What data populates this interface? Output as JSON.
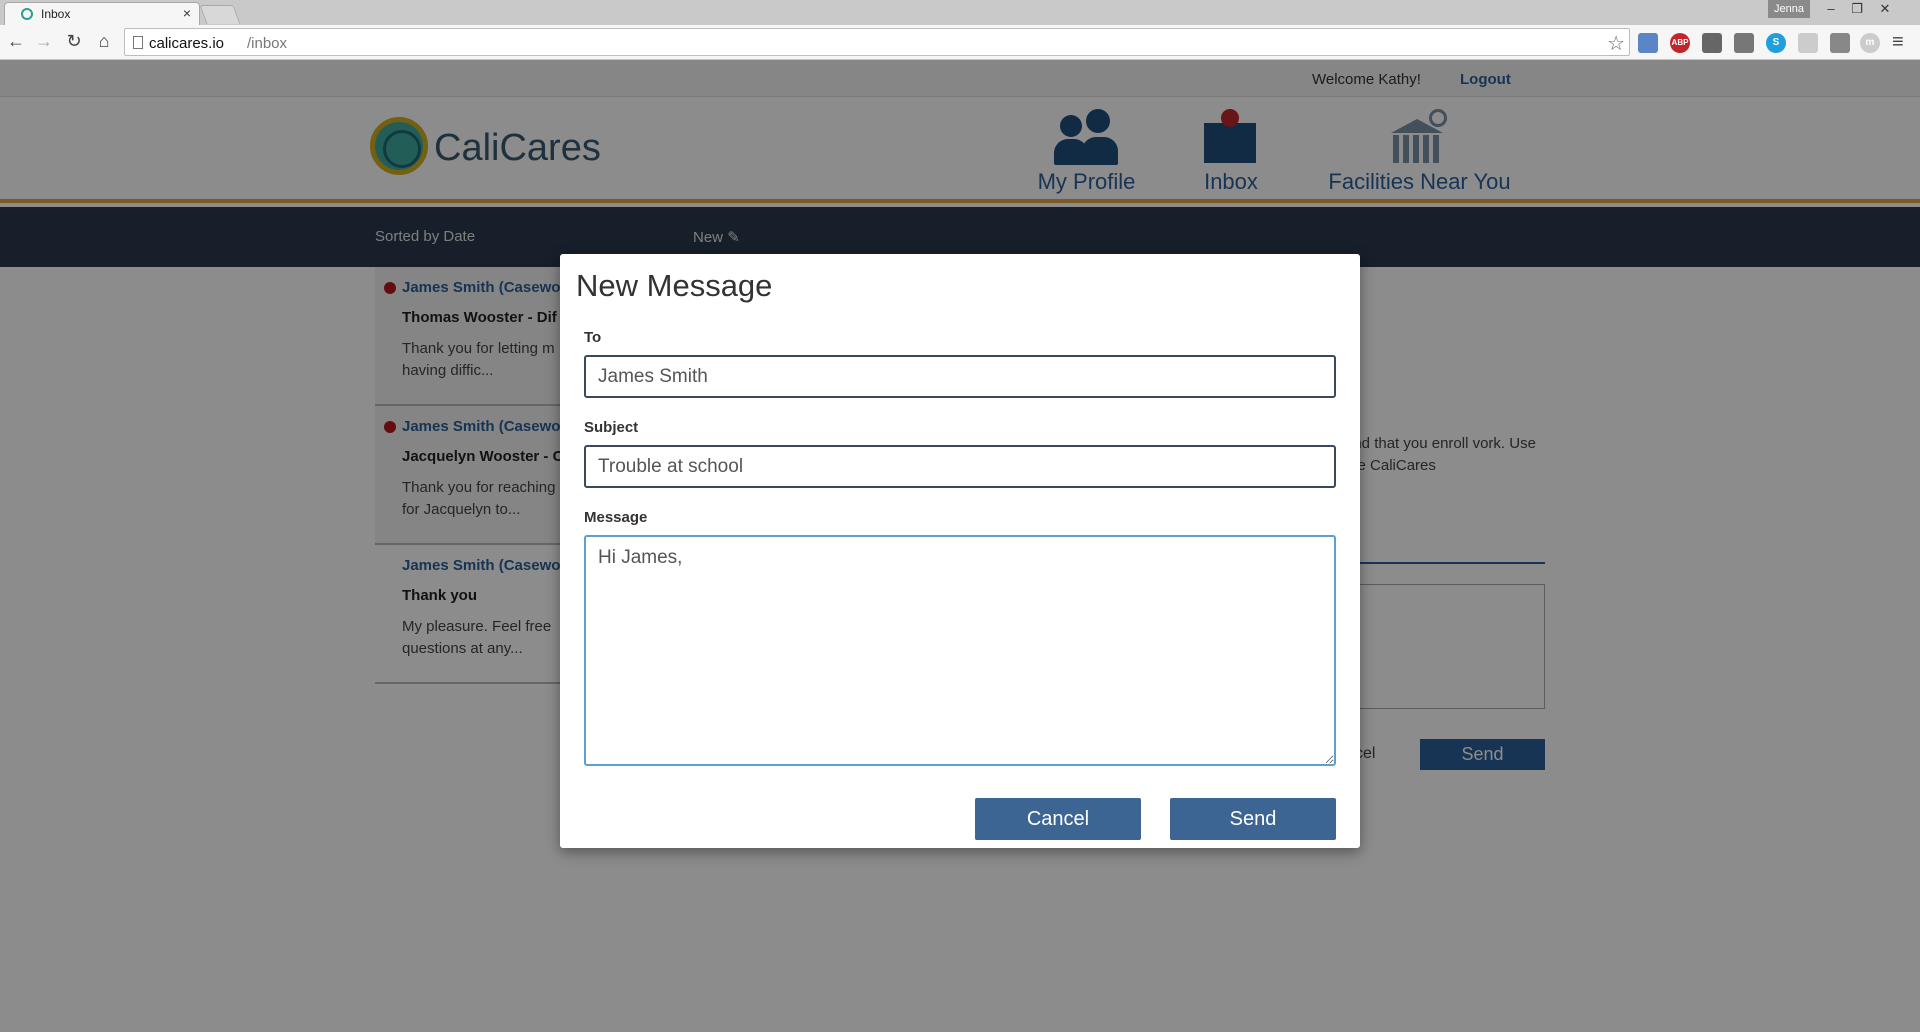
{
  "browser": {
    "tab_title": "Inbox",
    "tab_close": "×",
    "profile_name": "Jenna",
    "url_host": "calicares.io",
    "url_path": "/inbox",
    "extensions": [
      "abp-icon",
      "cast-icon",
      "camera-icon",
      "skype-icon",
      "bookmark-icon",
      "note-icon",
      "m-icon"
    ],
    "abp_label": "ABP"
  },
  "app": {
    "welcome_text": "Welcome Kathy!",
    "logout_label": "Logout",
    "brand_name": "CaliCares",
    "nav": {
      "profile": "My Profile",
      "inbox": "Inbox",
      "facilities": "Facilities Near You"
    },
    "toolbar": {
      "sorted_label": "Sorted by Date",
      "new_label": "New",
      "new_icon": "✎"
    },
    "messages": [
      {
        "from": "James Smith (Casewo",
        "subject": "Thomas Wooster - Dif",
        "preview": "Thank you for letting m having diffic...",
        "unread": true
      },
      {
        "from": "James Smith (Casewo",
        "subject": "Jacquelyn Wooster - C",
        "preview": "Thank you for reaching for Jacquelyn to...",
        "unread": true
      },
      {
        "from": "James Smith (Casewo",
        "subject": "Thank you",
        "preview": "My pleasure. Feel free questions at any...",
        "unread": false
      }
    ],
    "background_detail": {
      "text": "end that you enroll vork. Use the CaliCares",
      "cancel_label": "cel",
      "send_label": "Send"
    }
  },
  "modal": {
    "title": "New Message",
    "to_label": "To",
    "to_value": "James Smith",
    "subject_label": "Subject",
    "subject_value": "Trouble at school",
    "message_label": "Message",
    "message_value": "Hi James,",
    "cancel_label": "Cancel",
    "send_label": "Send"
  },
  "colors": {
    "accent_blue": "#3c6594",
    "header_stripe": "#e3a04a",
    "subbar": "#2b3a4f",
    "unread_dot": "#b7161e"
  }
}
